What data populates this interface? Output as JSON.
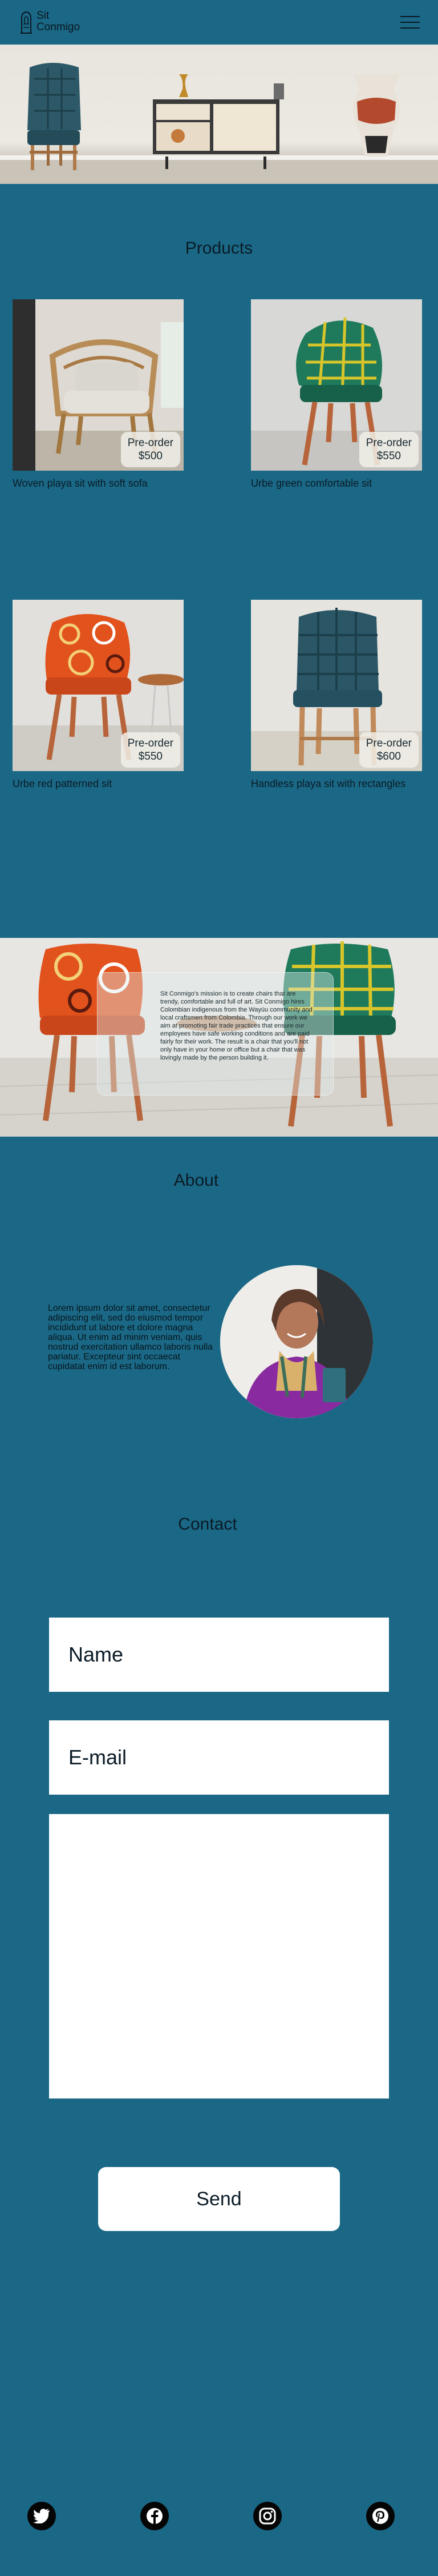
{
  "header": {
    "logo_line1": "Sit",
    "logo_line2": "Conmigo",
    "menu_icon": "hamburger-menu-icon"
  },
  "products": {
    "title": "Products",
    "items": [
      {
        "name": "Woven playa sit with soft sofa",
        "badge_line1": "Pre-order",
        "price": "$500"
      },
      {
        "name": "Urbe green comfortable sit",
        "badge_line1": "Pre-order",
        "price": "$550"
      },
      {
        "name": "Urbe red patterned sit",
        "badge_line1": "Pre-order",
        "price": "$550"
      },
      {
        "name": "Handless playa sit with rectangles",
        "badge_line1": "Pre-order",
        "price": "$600"
      }
    ]
  },
  "banner": {
    "mission_text": "Sit Conmigo's mission is to create chairs that are trendy, comfortable and full of art. Sit Conmigo hires Colombian indigenous from the Wayúu community and local craftsmen from Colombia. Through our work we aim at promoting fair trade practices that ensure our employees have safe working conditions and are paid fairly for their work. The result is a chair that you'll not only have in your home or office but a chair that was lovingly made by the person building it."
  },
  "about": {
    "title": "About",
    "text": "Lorem ipsum dolor sit amet, consectetur adipiscing elit, sed do eiusmod tempor incididunt ut labore et dolore magna aliqua. Ut enim ad minim veniam, quis nostrud exercitation ullamco laboris nulla pariatur. Excepteur sint occaecat cupidatat enim id est laborum."
  },
  "contact": {
    "title": "Contact",
    "name_placeholder": "Name",
    "email_placeholder": "E-mail",
    "message_placeholder": "",
    "send_label": "Send"
  },
  "footer": {
    "social": [
      "twitter-icon",
      "facebook-icon",
      "instagram-icon",
      "pinterest-icon"
    ]
  },
  "colors": {
    "background": "#1a6886",
    "text": "#0b1b26",
    "white": "#ffffff"
  }
}
